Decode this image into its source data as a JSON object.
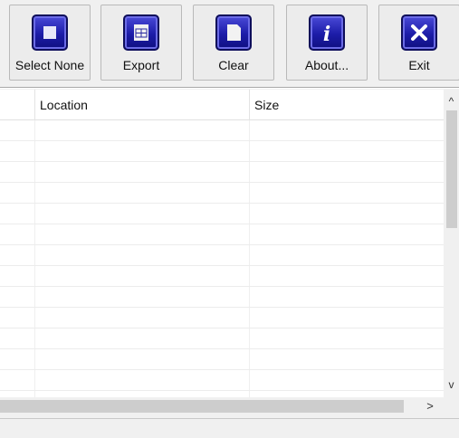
{
  "toolbar": {
    "buttons": [
      {
        "label": "Select None",
        "icon": "select-none-icon"
      },
      {
        "label": "Export",
        "icon": "export-icon"
      },
      {
        "label": "Clear",
        "icon": "clear-icon"
      },
      {
        "label": "About...",
        "icon": "about-icon"
      },
      {
        "label": "Exit",
        "icon": "exit-icon"
      }
    ],
    "icon_color": "#2020b0"
  },
  "grid": {
    "columns": [
      "",
      "Location",
      "Size"
    ],
    "rows": []
  },
  "scrollbars": {
    "up_arrow": "^",
    "down_arrow": "v",
    "right_arrow": ">"
  }
}
